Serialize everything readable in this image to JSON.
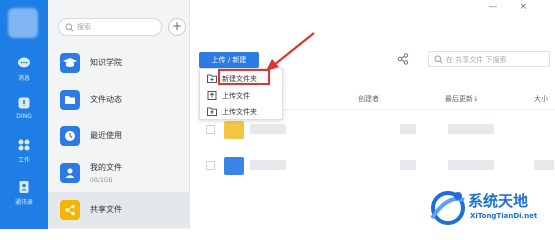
{
  "rail": {
    "items": [
      {
        "label": "消息",
        "icon": "chat-icon"
      },
      {
        "label": "DING",
        "icon": "ding-icon"
      },
      {
        "label": "工作",
        "icon": "apps-icon"
      },
      {
        "label": "通讯录",
        "icon": "contacts-icon"
      }
    ]
  },
  "nav": {
    "search_placeholder": "搜索",
    "add_icon": "plus-icon",
    "items": [
      {
        "label": "知识学院",
        "sub": "",
        "icon": "graduation-cap-icon"
      },
      {
        "label": "文件动态",
        "sub": "",
        "icon": "folder-icon"
      },
      {
        "label": "最近使用",
        "sub": "",
        "icon": "clock-icon"
      },
      {
        "label": "我的文件",
        "sub": "0B/2GB",
        "icon": "user-icon"
      },
      {
        "label": "共享文件",
        "sub": "",
        "icon": "share-icon",
        "active": true
      }
    ]
  },
  "window": {
    "minimize": "—",
    "close": "×"
  },
  "toolbar": {
    "upload_new_label": "上传 / 新建",
    "search_placeholder": "在 共享文件 下搜索"
  },
  "menu": {
    "items": [
      {
        "label": "新建文件夹",
        "icon": "new-folder-icon",
        "highlighted": true
      },
      {
        "label": "上传文件",
        "icon": "upload-file-icon"
      },
      {
        "label": "上传文件夹",
        "icon": "upload-folder-icon"
      }
    ]
  },
  "table": {
    "headers": {
      "creator": "创建者",
      "updated": "最后更新",
      "updated_sort": "↓",
      "size": "大小"
    }
  },
  "watermark": {
    "title": "系统天地",
    "url": "XiTongTianDi.net"
  },
  "colors": {
    "rail": "#1f7ee6",
    "accent": "#2c7be5",
    "highlight": "#e0342f",
    "folder": "#f4b400"
  }
}
